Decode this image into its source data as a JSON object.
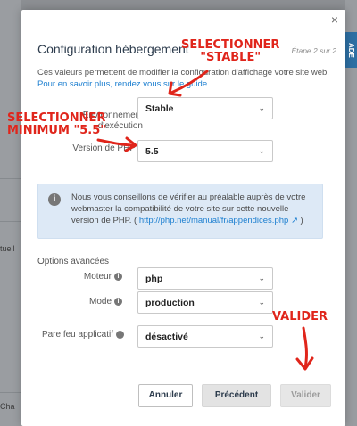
{
  "background": {
    "side_text_1": "tuell",
    "side_text_2": "Cha",
    "right_tab": "ADE"
  },
  "modal": {
    "close_glyph": "×",
    "title": "Configuration hébergement",
    "step": "Étape 2 sur 2",
    "description": "Ces valeurs permettent de modifier la configuration d'affichage votre site web.",
    "link_text": "Pour en savoir plus, rendez vous sur le guide.",
    "fields": {
      "environment": {
        "label": "Environnement d'exécution",
        "value": "Stable"
      },
      "php_version": {
        "label": "Version de PHP",
        "value": "5.5"
      }
    },
    "info": {
      "text": "Nous vous conseillons de vérifier au préalable auprès de votre webmaster la compatibilité de votre site sur cette nouvelle version de PHP. (",
      "link": "http://php.net/manual/fr/appendices.php",
      "close_paren": " )"
    },
    "advanced_title": "Options avancées",
    "advanced": {
      "engine": {
        "label": "Moteur",
        "value": "php"
      },
      "mode": {
        "label": "Mode",
        "value": "production"
      },
      "firewall": {
        "label": "Pare feu applicatif",
        "value": "désactivé"
      }
    },
    "buttons": {
      "cancel": "Annuler",
      "previous": "Précédent",
      "validate": "Valider"
    }
  },
  "annotations": {
    "select_stable": "SELECTIONNER\n\"STABLE\"",
    "select_min": "SELECTIONNER\nMINIMUM \"5.5\"",
    "validate": "VALIDER",
    "color": "#e0251b"
  },
  "icons": {
    "info": "info-icon",
    "help": "question-icon",
    "chevron": "chevron-down-icon",
    "close": "close-icon"
  }
}
